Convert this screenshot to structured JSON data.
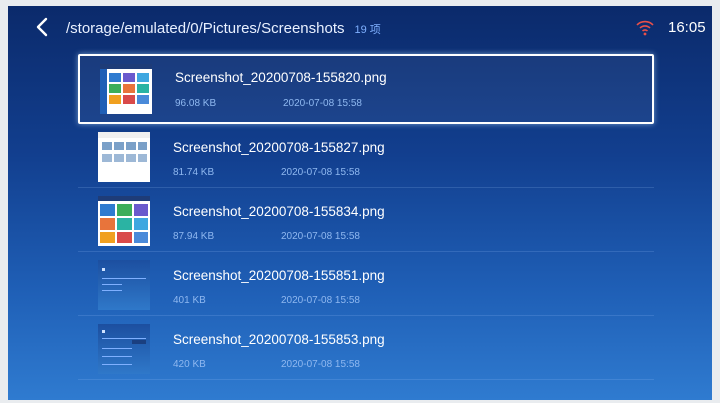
{
  "header": {
    "path": "/storage/emulated/0/Pictures/Screenshots",
    "count": "19 项",
    "time": "16:05"
  },
  "icons": {
    "back": "chevron-left-icon",
    "wifi": "wifi-icon"
  },
  "colors": {
    "accent": "#2f7bd0",
    "background_top": "#0b2a6b",
    "secondary_text": "#8fb8f0",
    "wifi_red": "#e8504a"
  },
  "files": [
    {
      "name": "Screenshot_20200708-155820.png",
      "size": "96.08 KB",
      "date": "2020-07-08 15:58"
    },
    {
      "name": "Screenshot_20200708-155827.png",
      "size": "81.74 KB",
      "date": "2020-07-08 15:58"
    },
    {
      "name": "Screenshot_20200708-155834.png",
      "size": "87.94 KB",
      "date": "2020-07-08 15:58"
    },
    {
      "name": "Screenshot_20200708-155851.png",
      "size": "401 KB",
      "date": "2020-07-08 15:58"
    },
    {
      "name": "Screenshot_20200708-155853.png",
      "size": "420 KB",
      "date": "2020-07-08 15:58"
    }
  ]
}
